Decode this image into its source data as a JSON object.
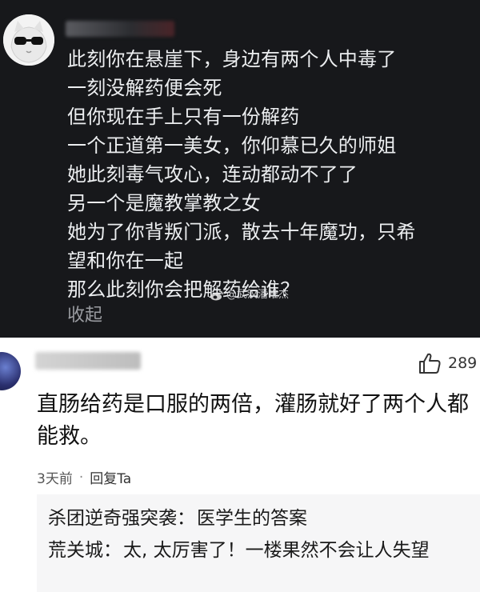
{
  "post": {
    "lines": [
      "此刻你在悬崖下，身边有两个人中毒了",
      "一刻没解药便会死",
      "但你现在手上只有一份解药",
      "一个正道第一美女，你仰慕已久的师姐",
      "她此刻毒气攻心，连动都动不了了",
      "另一个是魔教掌教之女",
      "她为了你背叛门派，散去十年魔功，只希",
      "望和你在一起",
      "那么此刻你会把解药给谁？"
    ],
    "collapse_label": "收起",
    "watermark": "@武汉潘唯杰"
  },
  "reply": {
    "like_count": "289",
    "text": "直肠给药是口服的两倍，灌肠就好了两个人都能救。",
    "time": "3天前",
    "separator": "·",
    "reply_label": "回复Ta",
    "sub_replies": [
      {
        "user": "杀团逆奇强突袭",
        "text": "医学生的答案"
      },
      {
        "user": "荒关城",
        "text": "太, 太厉害了！一楼果然不会让人失望"
      }
    ]
  },
  "colors": {
    "post_bg": "#17181b",
    "post_text": "#eceef0",
    "reply_bg": "#ffffff",
    "sub_reply_bg": "#f6f6f7"
  }
}
